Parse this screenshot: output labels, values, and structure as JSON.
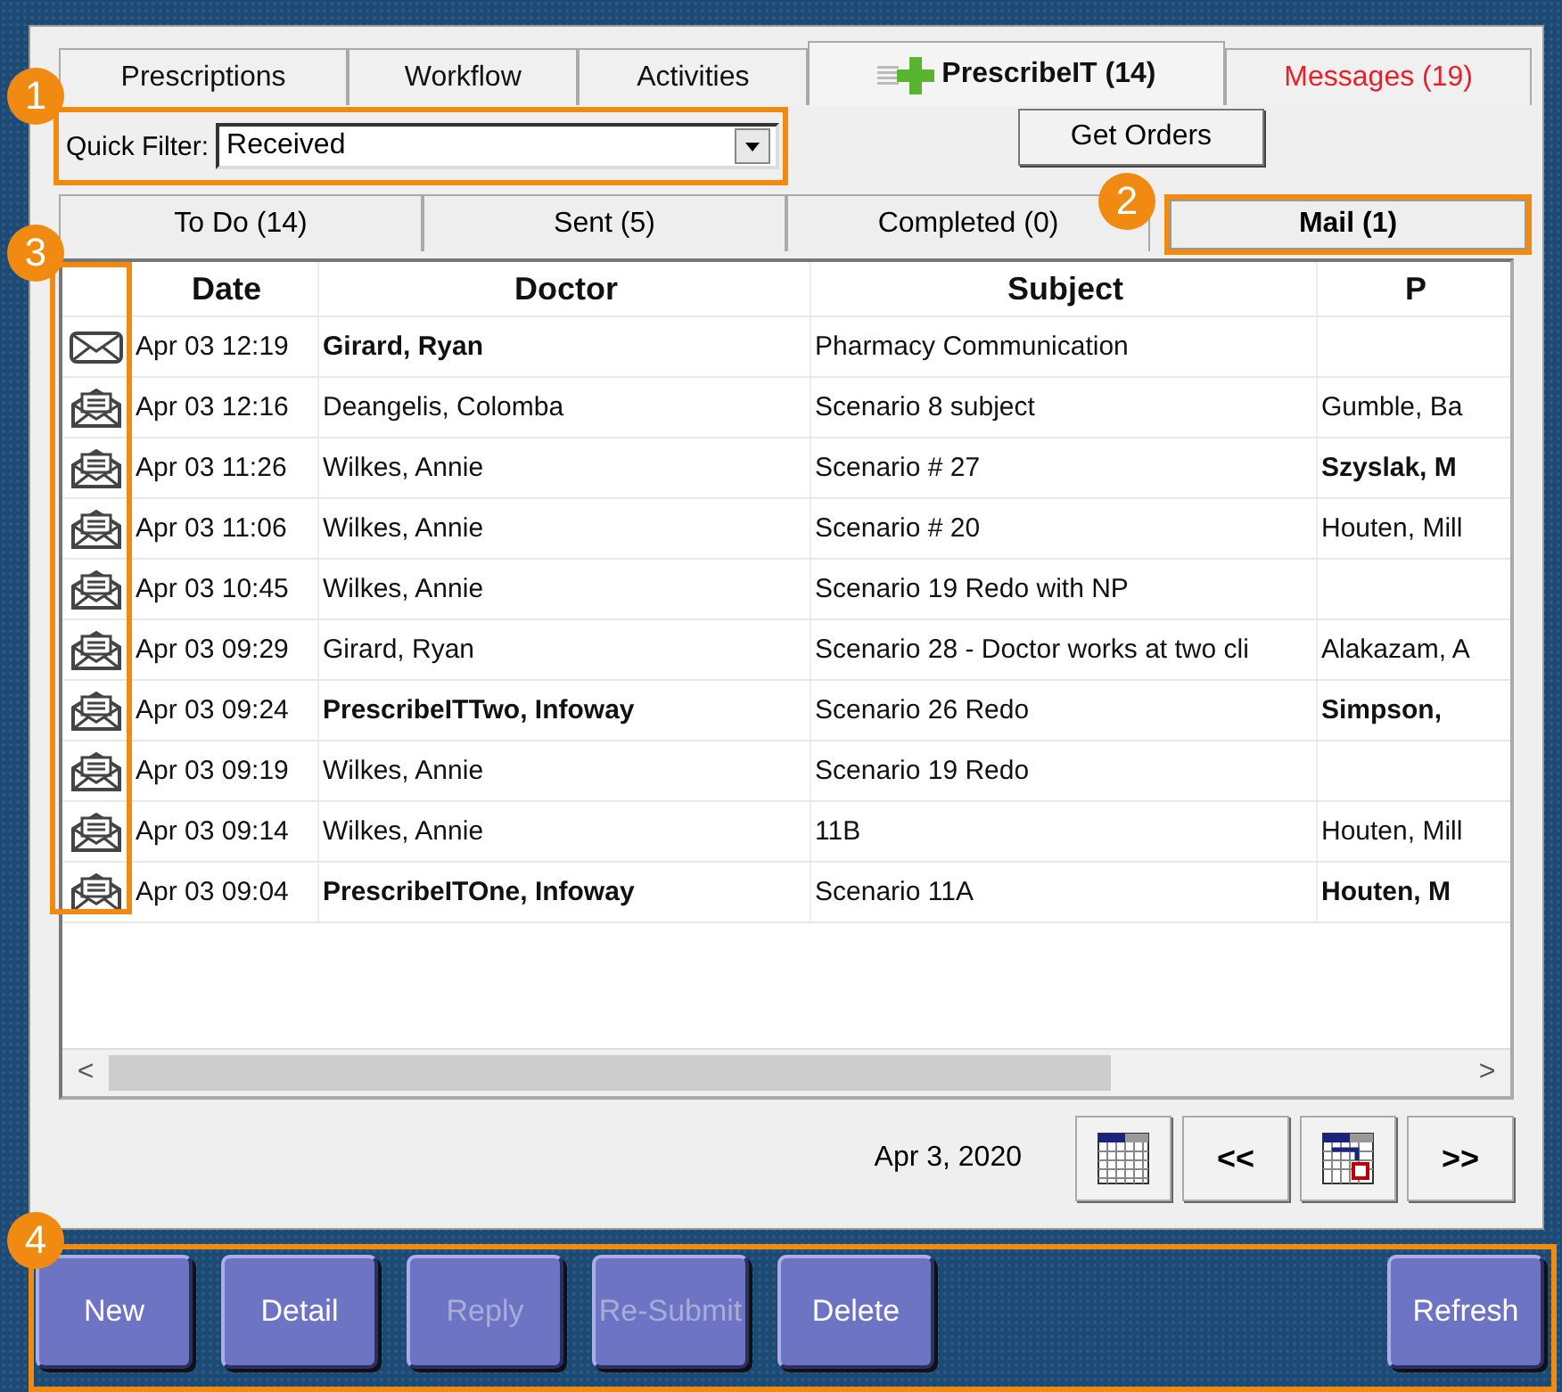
{
  "tabs": [
    {
      "label": "Prescriptions",
      "selected": false,
      "alert": false,
      "icon": false
    },
    {
      "label": "Workflow",
      "selected": false,
      "alert": false,
      "icon": false
    },
    {
      "label": "Activities",
      "selected": false,
      "alert": false,
      "icon": false
    },
    {
      "label": "PrescribeIT (14)",
      "selected": true,
      "alert": false,
      "icon": true
    },
    {
      "label": "Messages (19)",
      "selected": false,
      "alert": true,
      "icon": false
    }
  ],
  "quick_filter": {
    "label": "Quick Filter:",
    "value": "Received"
  },
  "get_orders_button": "Get Orders",
  "subtabs": [
    {
      "label": "To Do (14)",
      "selected": false
    },
    {
      "label": "Sent (5)",
      "selected": false
    },
    {
      "label": "Completed (0)",
      "selected": false
    },
    {
      "label": "Mail (1)",
      "selected": true
    }
  ],
  "table": {
    "columns": [
      "Date",
      "Doctor",
      "Subject",
      "P"
    ],
    "rows": [
      {
        "unread": true,
        "date": "Apr 03 12:19",
        "doctor": "Girard, Ryan",
        "doctor_bold": true,
        "subject": "Pharmacy Communication"
      },
      {
        "unread": false,
        "date": "Apr 03 12:16",
        "doctor": "Deangelis, Colomba",
        "doctor_bold": false,
        "subject": "Scenario 8 subject",
        "column_4": "Gumble, Ba",
        "column_4_bold": false
      },
      {
        "unread": false,
        "date": "Apr 03 11:26",
        "doctor": "Wilkes, Annie",
        "doctor_bold": false,
        "subject": "Scenario # 27",
        "column_4": "Szyslak, M",
        "column_4_bold": true
      },
      {
        "unread": false,
        "date": "Apr 03 11:06",
        "doctor": "Wilkes, Annie",
        "doctor_bold": false,
        "subject": "Scenario # 20",
        "column_4": "Houten, Mill",
        "column_4_bold": false
      },
      {
        "unread": false,
        "date": "Apr 03 10:45",
        "doctor": "Wilkes, Annie",
        "doctor_bold": false,
        "subject": "Scenario 19 Redo with NP"
      },
      {
        "unread": false,
        "date": "Apr 03 09:29",
        "doctor": "Girard, Ryan",
        "doctor_bold": false,
        "subject": "Scenario 28 - Doctor works at two cli",
        "column_4": "Alakazam, A",
        "column_4_bold": false
      },
      {
        "unread": false,
        "date": "Apr 03 09:24",
        "doctor": "PrescribeITTwo, Infoway",
        "doctor_bold": true,
        "subject": "Scenario 26 Redo",
        "column_4": "Simpson,",
        "column_4_bold": true
      },
      {
        "unread": false,
        "date": "Apr 03 09:19",
        "doctor": "Wilkes, Annie",
        "doctor_bold": false,
        "subject": "Scenario 19 Redo"
      },
      {
        "unread": false,
        "date": "Apr 03 09:14",
        "doctor": "Wilkes, Annie",
        "doctor_bold": false,
        "subject": "11B",
        "column_4": "Houten, Mill",
        "column_4_bold": false
      },
      {
        "unread": false,
        "date": "Apr 03 09:04",
        "doctor": "PrescribeITOne, Infoway",
        "doctor_bold": true,
        "subject": "Scenario 11A",
        "column_4": "Houten, M",
        "column_4_bold": true
      }
    ]
  },
  "scroll_left": "<",
  "scroll_right": ">",
  "date_nav": {
    "date": "Apr 3, 2020",
    "prev": "<<",
    "next": ">>"
  },
  "buttons": [
    {
      "label": "New",
      "disabled": false
    },
    {
      "label": "Detail",
      "disabled": false
    },
    {
      "label": "Reply",
      "disabled": true
    },
    {
      "label": "Re-Submit",
      "disabled": true
    },
    {
      "label": "Delete",
      "disabled": false
    },
    {
      "label": "Refresh",
      "disabled": false
    }
  ],
  "callouts": [
    "1",
    "2",
    "3",
    "4"
  ]
}
